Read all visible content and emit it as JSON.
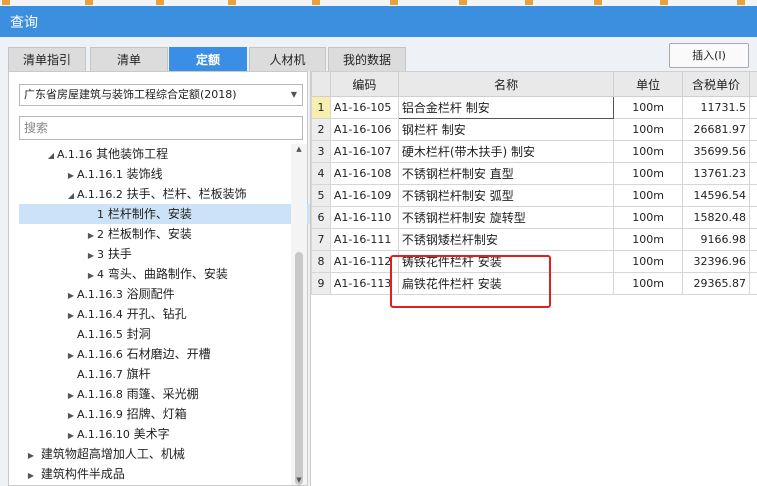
{
  "window": {
    "title": "查询"
  },
  "tabs": [
    {
      "label": "清单指引",
      "active": false
    },
    {
      "label": "清单",
      "active": false
    },
    {
      "label": "定额",
      "active": true
    },
    {
      "label": "人材机",
      "active": false
    },
    {
      "label": "我的数据",
      "active": false
    }
  ],
  "toolbar": {
    "insert_label": "插入(I)"
  },
  "left_panel": {
    "quota_library": "广东省房屋建筑与装饰工程综合定额(2018)",
    "search_placeholder": "搜索",
    "tree": [
      {
        "code": "A.1.16",
        "label": "其他装饰工程",
        "toggle": "◢",
        "level": 1,
        "selected": false
      },
      {
        "code": "A.1.16.1",
        "label": "装饰线",
        "toggle": "▶",
        "level": 2,
        "selected": false
      },
      {
        "code": "A.1.16.2",
        "label": "扶手、栏杆、栏板装饰",
        "toggle": "◢",
        "level": 2,
        "selected": false
      },
      {
        "code": "1",
        "label": "栏杆制作、安装",
        "toggle": "",
        "level": 3,
        "selected": true
      },
      {
        "code": "2",
        "label": "栏板制作、安装",
        "toggle": "▶",
        "level": 3,
        "selected": false
      },
      {
        "code": "3",
        "label": "扶手",
        "toggle": "▶",
        "level": 3,
        "selected": false
      },
      {
        "code": "4",
        "label": "弯头、曲路制作、安装",
        "toggle": "▶",
        "level": 3,
        "selected": false
      },
      {
        "code": "A.1.16.3",
        "label": "浴厕配件",
        "toggle": "▶",
        "level": 2,
        "selected": false
      },
      {
        "code": "A.1.16.4",
        "label": "开孔、钻孔",
        "toggle": "▶",
        "level": 2,
        "selected": false
      },
      {
        "code": "A.1.16.5",
        "label": "封洞",
        "toggle": "",
        "level": 2,
        "selected": false
      },
      {
        "code": "A.1.16.6",
        "label": "石材磨边、开槽",
        "toggle": "▶",
        "level": 2,
        "selected": false
      },
      {
        "code": "A.1.16.7",
        "label": "旗杆",
        "toggle": "",
        "level": 2,
        "selected": false
      },
      {
        "code": "A.1.16.8",
        "label": "雨篷、采光棚",
        "toggle": "▶",
        "level": 2,
        "selected": false
      },
      {
        "code": "A.1.16.9",
        "label": "招牌、灯箱",
        "toggle": "▶",
        "level": 2,
        "selected": false
      },
      {
        "code": "A.1.16.10",
        "label": "美术字",
        "toggle": "▶",
        "level": 2,
        "selected": false
      },
      {
        "code": "",
        "label": "建筑物超高增加人工、机械",
        "toggle": "▶",
        "level": 0,
        "selected": false
      },
      {
        "code": "",
        "label": "建筑构件半成品",
        "toggle": "▶",
        "level": 0,
        "selected": false
      }
    ]
  },
  "table": {
    "columns": [
      "",
      "编码",
      "名称",
      "单位",
      "含税单价"
    ],
    "rows": [
      {
        "idx": "1",
        "code": "A1-16-105",
        "name": "铝合金栏杆 制安",
        "unit": "100m",
        "price": "11731.5"
      },
      {
        "idx": "2",
        "code": "A1-16-106",
        "name": "钢栏杆 制安",
        "unit": "100m",
        "price": "26681.97"
      },
      {
        "idx": "3",
        "code": "A1-16-107",
        "name": "硬木栏杆(带木扶手) 制安",
        "unit": "100m",
        "price": "35699.56"
      },
      {
        "idx": "4",
        "code": "A1-16-108",
        "name": "不锈钢栏杆制安 直型",
        "unit": "100m",
        "price": "13761.23"
      },
      {
        "idx": "5",
        "code": "A1-16-109",
        "name": "不锈钢栏杆制安 弧型",
        "unit": "100m",
        "price": "14596.54"
      },
      {
        "idx": "6",
        "code": "A1-16-110",
        "name": "不锈钢栏杆制安 旋转型",
        "unit": "100m",
        "price": "15820.48"
      },
      {
        "idx": "7",
        "code": "A1-16-111",
        "name": "不锈钢矮栏杆制安",
        "unit": "100m",
        "price": "9166.98"
      },
      {
        "idx": "8",
        "code": "A1-16-112",
        "name": "铸铁花件栏杆 安装",
        "unit": "100m",
        "price": "32396.96"
      },
      {
        "idx": "9",
        "code": "A1-16-113",
        "name": "扁铁花件栏杆 安装",
        "unit": "100m",
        "price": "29365.87"
      }
    ]
  },
  "colors": {
    "titlebar": "#3c8fdf",
    "active_tab": "#3a8ee6",
    "highlight_box": "#e02020",
    "selected_node": "#cce3f7"
  }
}
